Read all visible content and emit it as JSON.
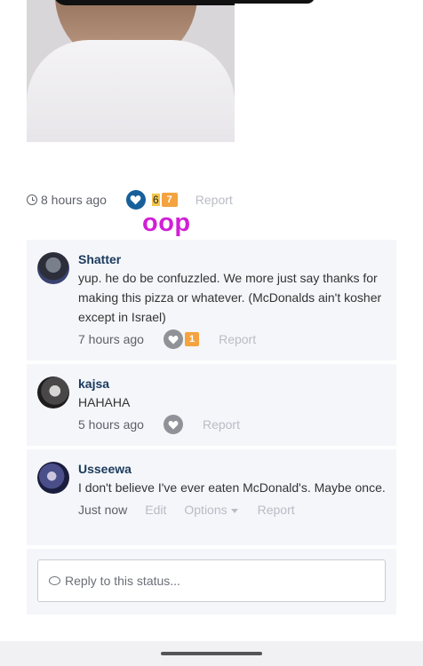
{
  "post": {
    "timestamp": "8 hours ago",
    "reaction_count_previous": "6",
    "reaction_count": "7",
    "report_label": "Report",
    "overlay_text": "oop"
  },
  "comments": [
    {
      "author": "Shatter",
      "text": "yup. he do be confuzzled. We more just say thanks for making this pizza or whatever. (McDonalds ain't kosher except in Israel)",
      "timestamp": "7 hours ago",
      "reaction_count": "1",
      "report_label": "Report"
    },
    {
      "author": "kajsa",
      "text": "HAHAHA",
      "timestamp": "5 hours ago",
      "report_label": "Report"
    },
    {
      "author": "Usseewa",
      "text": "I don't believe I've ever eaten McDonald's. Maybe once.",
      "timestamp": "Just now",
      "edit_label": "Edit",
      "options_label": "Options",
      "report_label": "Report"
    }
  ],
  "reply": {
    "placeholder": "Reply to this status..."
  },
  "colors": {
    "accent": "#17609a",
    "badge": "#f4a340",
    "overlay": "#d11fd6",
    "comment_bg": "#f4f6fa"
  }
}
